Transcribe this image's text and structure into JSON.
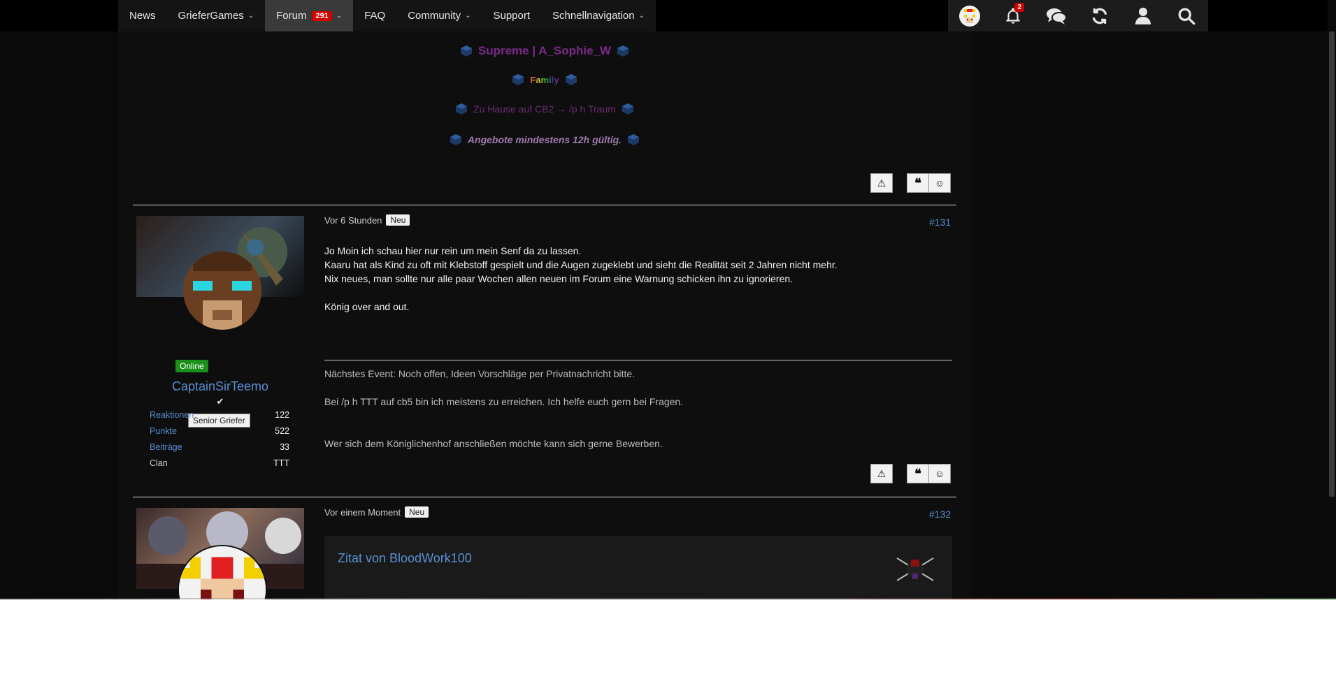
{
  "nav": {
    "items": [
      {
        "label": "News",
        "caret": false
      },
      {
        "label": "GrieferGames",
        "caret": true
      },
      {
        "label": "Forum",
        "caret": true,
        "badge": "291",
        "active": true
      },
      {
        "label": "FAQ",
        "caret": false
      },
      {
        "label": "Community",
        "caret": true
      },
      {
        "label": "Support",
        "caret": false
      },
      {
        "label": "Schnellnavigation",
        "caret": true
      }
    ],
    "notification_count": "2"
  },
  "prev_signature": {
    "line1": "Supreme | A_Sophie_W",
    "line2": "Family",
    "line3": "Zu Hause auf CB2 → /p h Traum",
    "line4": "Angebote mindestens 12h gültig."
  },
  "post131": {
    "time": "Vor 6 Stunden",
    "badge": "Neu",
    "number": "#131",
    "body": [
      "Jo Moin ich schau hier nur rein um mein Senf da zu lassen.",
      "Kaaru hat als Kind zu oft mit Klebstoff gespielt und die Augen zugeklebt und sieht die Realität seit 2 Jahren nicht mehr.",
      "Nix neues, man sollte nur alle paar Wochen allen neuen im Forum eine Warnung schicken ihn zu ignorieren.",
      "König over and out."
    ],
    "signature": [
      "Nächstes Event: Noch offen, Ideen Vorschläge per Privatnachricht bitte.",
      "Bei /p h TTT auf cb5 bin ich meistens zu erreichen. Ich helfe euch gern bei Fragen.",
      "Wer sich dem Königlichenhof anschließen möchte kann sich gerne Bewerben."
    ],
    "author": {
      "status": "Online",
      "name": "CaptainSirTeemo",
      "verified": "✔",
      "rank": "Senior Griefer",
      "stats": [
        {
          "label": "Reaktionen",
          "value": "122"
        },
        {
          "label": "Punkte",
          "value": "522"
        },
        {
          "label": "Beiträge",
          "value": "33"
        },
        {
          "label": "Clan",
          "value": "TTT"
        }
      ]
    }
  },
  "post132": {
    "time": "Vor einem Moment",
    "badge": "Neu",
    "number": "#132",
    "quote_title": "Zitat von BloodWork100"
  },
  "colors": {
    "link": "#5a8ed1",
    "online": "#1a8f1a",
    "badge_red": "#d10000",
    "sig_purple": "#6b2a74"
  }
}
